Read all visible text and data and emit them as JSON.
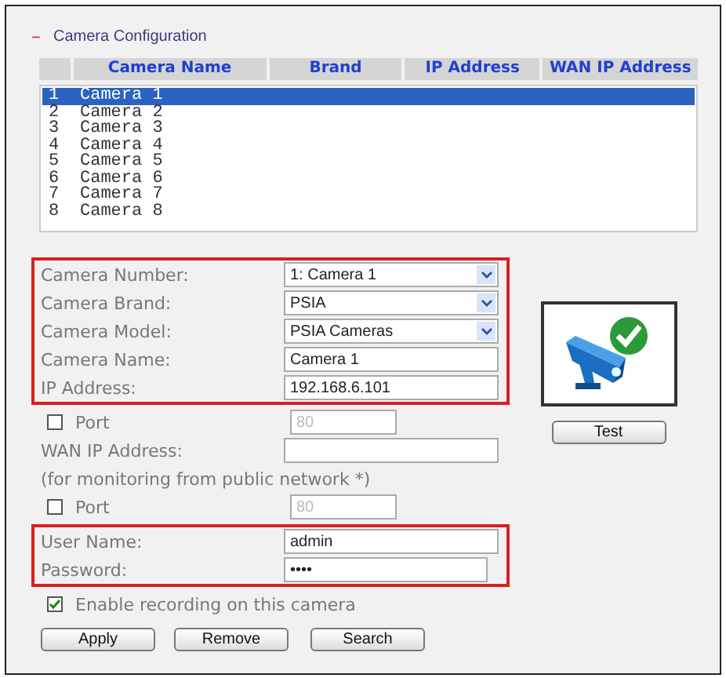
{
  "section": {
    "title": "Camera Configuration",
    "collapse_symbol": "–"
  },
  "table": {
    "columns": [
      "",
      "Camera Name",
      "Brand",
      "IP Address",
      "WAN IP Address"
    ],
    "rows": [
      {
        "number": "1",
        "name": "Camera 1",
        "selected": true
      },
      {
        "number": "2",
        "name": "Camera 2",
        "selected": false
      },
      {
        "number": "3",
        "name": "Camera 3",
        "selected": false
      },
      {
        "number": "4",
        "name": "Camera 4",
        "selected": false
      },
      {
        "number": "5",
        "name": "Camera 5",
        "selected": false
      },
      {
        "number": "6",
        "name": "Camera 6",
        "selected": false
      },
      {
        "number": "7",
        "name": "Camera 7",
        "selected": false
      },
      {
        "number": "8",
        "name": "Camera 8",
        "selected": false
      }
    ]
  },
  "groups": [
    {
      "highlighted": true,
      "fields": [
        {
          "kind": "select",
          "label": "Camera Number:",
          "value": "1: Camera 1"
        },
        {
          "kind": "select",
          "label": "Camera Brand:",
          "value": "PSIA"
        },
        {
          "kind": "select",
          "label": "Camera Model:",
          "value": "PSIA Cameras"
        },
        {
          "kind": "text",
          "label": "Camera Name:",
          "value": "Camera 1"
        },
        {
          "kind": "text",
          "label": "IP Address:",
          "value": "192.168.6.101"
        }
      ]
    },
    {
      "highlighted": false,
      "fields": [
        {
          "kind": "port",
          "label": "Port",
          "checked": false,
          "value": "80",
          "disabled": true
        },
        {
          "kind": "text",
          "label": "WAN IP Address:"
        },
        {
          "kind": "note",
          "label": "(for monitoring from public network *)"
        },
        {
          "kind": "port",
          "label": "Port",
          "checked": false,
          "value": "80",
          "disabled": true
        }
      ]
    },
    {
      "highlighted": true,
      "fields": [
        {
          "kind": "text",
          "label": "User Name:",
          "value": "admin"
        },
        {
          "kind": "password",
          "label": "Password:",
          "value": "••••"
        }
      ]
    },
    {
      "highlighted": false,
      "fields": [
        {
          "kind": "checkbox",
          "label": "Enable recording on this camera",
          "checked": true
        }
      ]
    }
  ],
  "status": {
    "ok": true
  },
  "test_button": "Test",
  "buttons": [
    "Apply",
    "Remove",
    "Search"
  ]
}
